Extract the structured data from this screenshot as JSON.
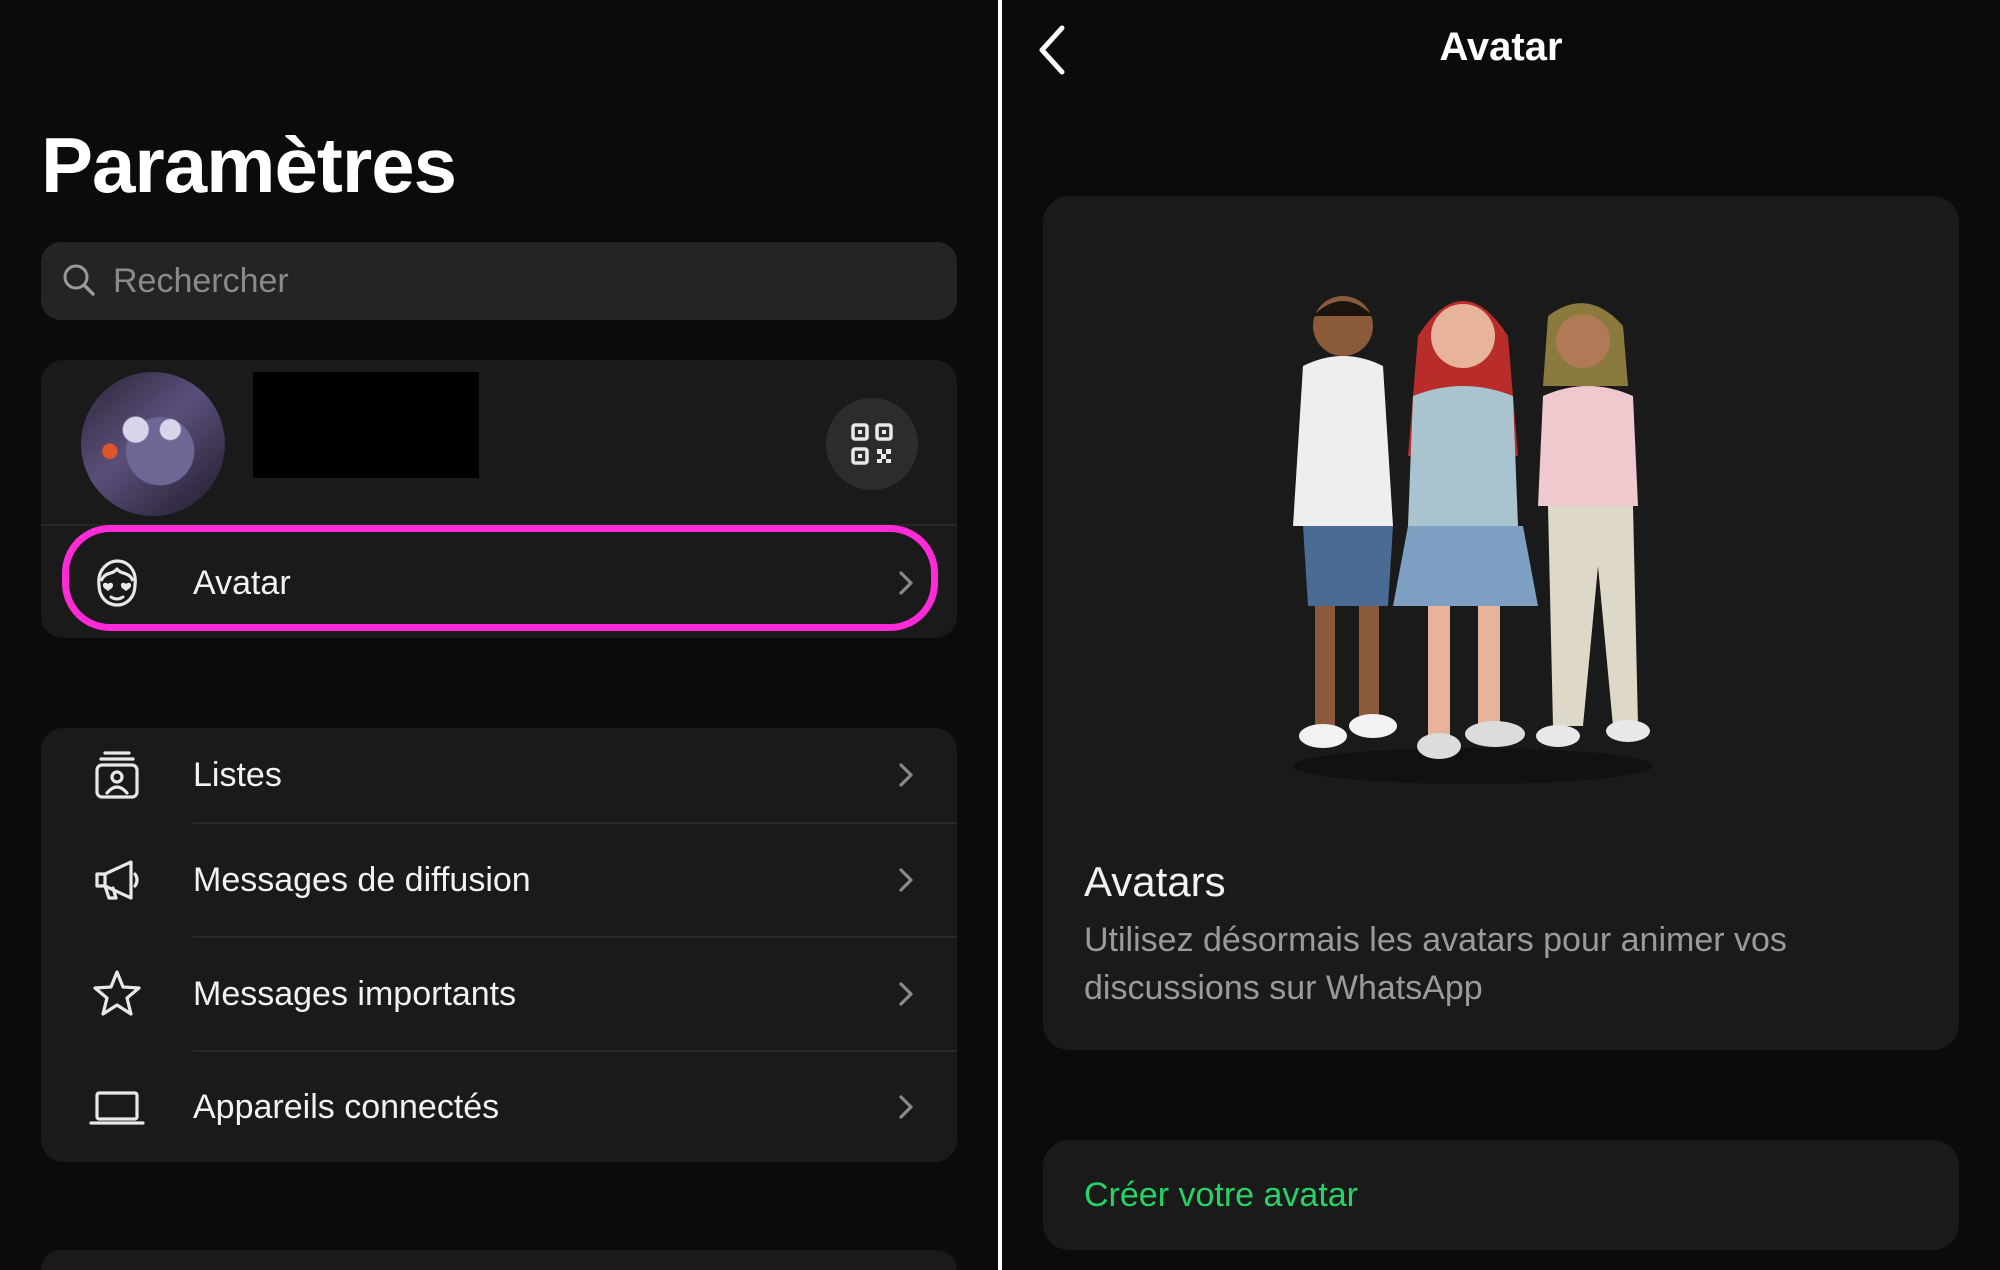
{
  "settings": {
    "title": "Paramètres",
    "search": {
      "placeholder": "Rechercher",
      "icon": "search-icon"
    },
    "profile": {
      "qr_icon": "qr-code-icon"
    },
    "avatar_row": {
      "label": "Avatar",
      "icon": "avatar-face-icon",
      "highlight_color": "#ff2bd6"
    },
    "menu": [
      {
        "label": "Listes",
        "icon": "lists-icon"
      },
      {
        "label": "Messages de diffusion",
        "icon": "megaphone-icon"
      },
      {
        "label": "Messages importants",
        "icon": "star-icon"
      },
      {
        "label": "Appareils connectés",
        "icon": "laptop-icon"
      }
    ]
  },
  "avatar_screen": {
    "nav_title": "Avatar",
    "promo_title": "Avatars",
    "promo_desc": "Utilisez désormais les avatars pour animer vos discussions sur WhatsApp",
    "create_label": "Créer votre avatar"
  },
  "colors": {
    "background": "#0b0b0b",
    "card": "#1a1a1a",
    "accent_green": "#25d366",
    "highlight": "#ff2bd6"
  }
}
